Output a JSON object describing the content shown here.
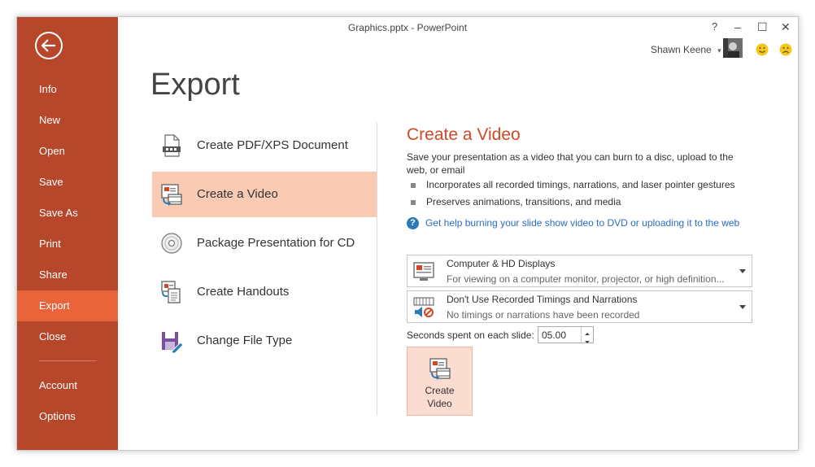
{
  "window": {
    "title": "Graphics.pptx - PowerPoint",
    "help": "?",
    "minimize": "–",
    "maximize": "☐",
    "close": "✕",
    "user_name": "Shawn Keene",
    "user_caret": "▾"
  },
  "sidebar": {
    "items": [
      {
        "label": "Info"
      },
      {
        "label": "New"
      },
      {
        "label": "Open"
      },
      {
        "label": "Save"
      },
      {
        "label": "Save As"
      },
      {
        "label": "Print"
      },
      {
        "label": "Share"
      },
      {
        "label": "Export",
        "active": true
      },
      {
        "label": "Close"
      },
      {
        "label": "Account"
      },
      {
        "label": "Options"
      }
    ]
  },
  "page": {
    "title": "Export",
    "options": [
      {
        "label": "Create PDF/XPS Document",
        "icon": "pdf-document-icon"
      },
      {
        "label": "Create a Video",
        "icon": "video-icon",
        "active": true
      },
      {
        "label": "Package Presentation for CD",
        "icon": "cd-icon"
      },
      {
        "label": "Create Handouts",
        "icon": "handouts-icon"
      },
      {
        "label": "Change File Type",
        "icon": "file-type-icon"
      }
    ]
  },
  "video_pane": {
    "title": "Create a Video",
    "description": "Save your presentation as a video that you can burn to a disc, upload to the web, or email",
    "bullets": [
      "Incorporates all recorded timings, narrations, and laser pointer gestures",
      "Preserves animations, transitions, and media"
    ],
    "help_link": "Get help burning your slide show video to DVD or uploading it to the web",
    "quality_dropdown": {
      "main": "Computer & HD Displays",
      "sub": "For viewing on a computer monitor, projector, or high definition..."
    },
    "timings_dropdown": {
      "main": "Don't Use Recorded Timings and Narrations",
      "sub": "No timings or narrations have been recorded"
    },
    "seconds_label": "Seconds spent on each slide:",
    "seconds_value": "05.00",
    "create_button_line1": "Create",
    "create_button_line2": "Video"
  },
  "colors": {
    "sidebar": "#b7472a",
    "sidebar_active": "#e9643b",
    "accent_title": "#d24726",
    "selected_option": "#f9cbb5",
    "link": "#2a6ebb"
  }
}
